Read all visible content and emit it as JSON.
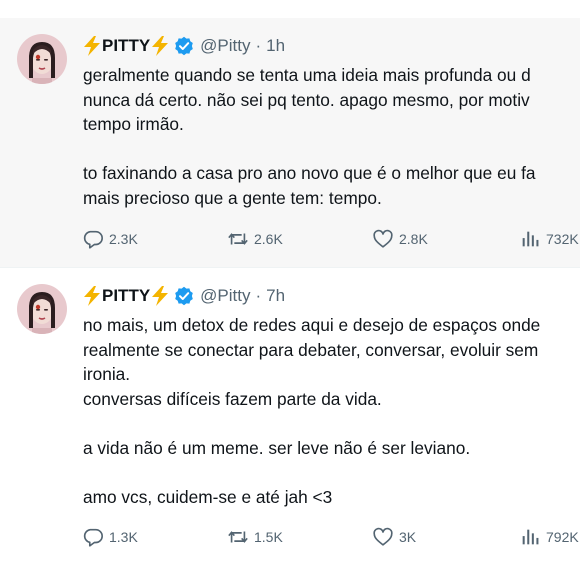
{
  "colors": {
    "verified": "#1d9bf0",
    "bolt": "#f4b400",
    "muted": "#536471",
    "text": "#0f1419"
  },
  "icons": [
    "lightning-icon",
    "verified-badge-icon",
    "reply-icon",
    "retweet-icon",
    "like-icon",
    "views-icon"
  ],
  "tweets": [
    {
      "author": {
        "name": "PITTY",
        "handle": "@Pitty"
      },
      "separator": "·",
      "time": "1h",
      "lines": [
        "geralmente quando se tenta uma ideia mais profunda ou d",
        "nunca dá certo. não sei pq tento. apago mesmo, por motiv",
        "tempo irmão.",
        "",
        "to faxinando a casa pro ano novo que é o melhor que eu fa",
        "mais precioso que a gente tem: tempo."
      ],
      "stats": {
        "replies": "2.3K",
        "reposts": "2.6K",
        "likes": "2.8K",
        "views": "732K"
      }
    },
    {
      "author": {
        "name": "PITTY",
        "handle": "@Pitty"
      },
      "separator": "·",
      "time": "7h",
      "lines": [
        "no mais, um detox de redes aqui e desejo de espaços onde",
        "realmente se conectar para debater, conversar, evoluir sem",
        "ironia.",
        "conversas difíceis fazem parte da vida.",
        "",
        "a vida não é um meme. ser leve não é ser leviano.",
        "",
        "amo vcs, cuidem-se e até jah <3"
      ],
      "stats": {
        "replies": "1.3K",
        "reposts": "1.5K",
        "likes": "3K",
        "views": "792K"
      }
    }
  ]
}
